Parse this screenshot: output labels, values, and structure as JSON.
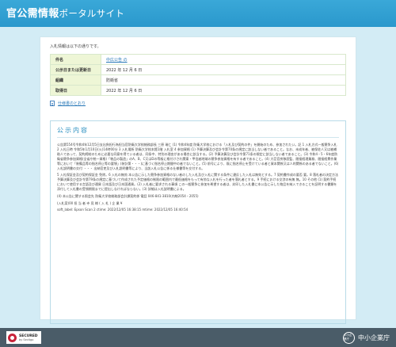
{
  "header": {
    "title_main": "官公需情報",
    "title_sub": "ポータルサイト"
  },
  "intro_text": "入札情報は以下の通りです。",
  "info_table": [
    {
      "label": "件名",
      "value": "中広公告 の",
      "is_link": true
    },
    {
      "label": "公示日または更新日",
      "value": "2022 年 12 月 6 日",
      "is_link": false
    },
    {
      "label": "組織",
      "value": "防衛省",
      "is_link": false
    },
    {
      "label": "取得日",
      "value": "2022 年 12 月 6 日",
      "is_link": false
    }
  ],
  "spec_link": "仕様書のとおり",
  "notice": {
    "title": "公示内容",
    "paragraphs": [
      "公告第554号令和4年12月5日支出負担行為担当官防衛大学校総務部長 三原 瑞仁 (1) 令和4年度 防衛大学校における「入札及び契約の件」を開始のため、参加されたい。記 1 入札方式一般競争入札 2 入札日時 令和5年1月10日(火)14時00分 3 入札場所 防衛大学校本館1階 入札室 4 参加資格 (1) 予算決算及び会計令第70条の規定に該当しない者であること。なお、未成年者、被保佐人又は被補助人であって、契約締結のために必要な同意を得ている者は、同条中、特別の理由がある場合に該当する。(2) 予算決算及び会計令第71条の規定に該当しない者であること。(3) 令和4・5・6年度防衛省競争参加資格(全省庁統一資格)「物品の製造」のA、B、C又はDの等級に格付けされ関東・甲信越地域の競争参加資格を有する者であること。(4) 大臣官房移設監、間接経理業務、間接経費作業等において「装備品等の指名停止等の要領」(装計第・・・)に基づく指名停止期間中の者でないこと。(5) 前号により、既に指名停止を受けている者と資本関係又は人的関係のある者でないこと。(6) 入札説明書の交付 ・・・ 出納官吏及び入札説明書等により、当該入札公告に係る仕様書等を交付する。",
      "5 入札保証金及び契約保証金 免除。6 入札の無効 本公告に示した競争参加資格のない者のした入札及び入札に関する条件に違反した入札は無効とする。7 契約書作成の要否 要。8 落札者の決定方法 予算決算及び会計令第79条の規定に基づいて作成された予定価格の制限の範囲内で最低価格をもって有効な入札を行った者を落札者とする。9 手続における交渉の有無 無。10 その他 (1) 契約手続において使用する言語及び通貨 日本語及び日本国通貨。(2) 入札者に要求される事項 この一般競争に参加を希望する者は、封印した入札書に本公告に示した物品を納入できることを証明する書類を添付して入札書の受領期限までに提出しなければならない。(3) 詳細は入札説明書による。",
      "(4) 本公告に関する照会先 防衛大学校総務部会計課契約係 電話 046-841-3810(内線2054・2055)"
    ],
    "signature": "(入札案)00 担 当 者 寺 見 様 ( 入 札 ) 企 業 ¥",
    "meta": "soft_label: Epson Scan 2 ctime: 2022/12/05 16:38:15 mtime: 2022/12/05 16:40:54"
  },
  "footer": {
    "secured_line1": "SECURED",
    "secured_line2": "by Sectigo",
    "org_mark": "中小企業庁",
    "org_name": "中小企業庁"
  },
  "colors": {
    "header_bg": "#2a98cc",
    "page_bg": "#d3ecf5",
    "table_label_bg": "#eef6d6",
    "accent": "#2a8fc0",
    "footer_bg": "#4a5c68"
  }
}
